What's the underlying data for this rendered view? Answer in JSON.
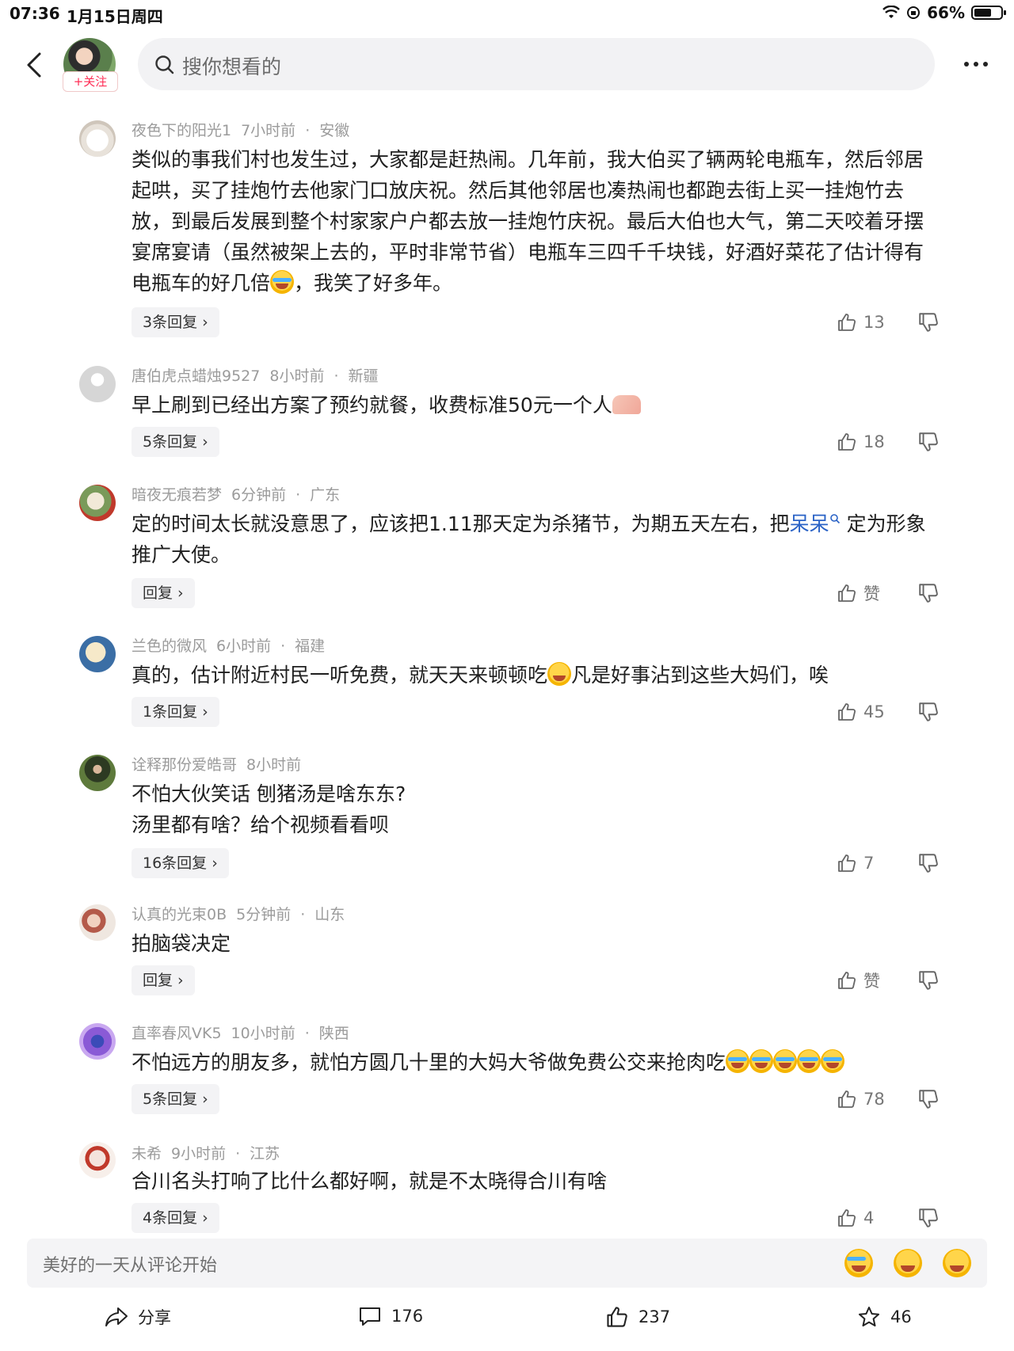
{
  "status": {
    "time": "07:36",
    "date": "1月15日周四",
    "battery": "66%",
    "battery_level": 0.66
  },
  "header": {
    "follow_label": "+关注",
    "search_placeholder": "搜你想看的"
  },
  "comments": [
    {
      "user": "夜色下的阳光1",
      "time": "7小时前",
      "location": "安徽",
      "text_parts": [
        "类似的事我们村也发生过，大家都是赶热闹。几年前，我大伯买了辆两轮电瓶车，然后邻居起哄，买了挂炮竹去他家门口放庆祝。然后其他邻居也凑热闹也都跑去街上买一挂炮竹去放，到最后发展到整个村家家户户都去放一挂炮竹庆祝。最后大伯也大气，第二天咬着牙摆宴席宴请（虽然被架上去的，平时非常节省）电瓶车三四千千块钱，好酒好菜花了估计得有电瓶车的好几倍",
        "，我笑了好多年。"
      ],
      "replies": "3条回复",
      "likes": "13"
    },
    {
      "user": "唐伯虎点蜡烛9527",
      "time": "8小时前",
      "location": "新疆",
      "text_parts": [
        "早上刷到已经出方案了预约就餐，收费标准50元一个人"
      ],
      "replies": "5条回复",
      "likes": "18"
    },
    {
      "user": "暗夜无痕若梦",
      "time": "6分钟前",
      "location": "广东",
      "text_parts": [
        "定的时间太长就没意思了，应该把1.11那天定为杀猪节，为期五天左右，把",
        "呆呆",
        "定为形象推广大使。"
      ],
      "replies": "回复",
      "likes": "赞"
    },
    {
      "user": "兰色的微风",
      "time": "6小时前",
      "location": "福建",
      "text_parts": [
        "真的，估计附近村民一听免费，就天天来顿顿吃",
        "凡是好事沾到这些大妈们，唉"
      ],
      "replies": "1条回复",
      "likes": "45"
    },
    {
      "user": "诠释那份爱皓哥",
      "time": "8小时前",
      "location": "",
      "text_parts": [
        "不怕大伙笑话 刨猪汤是啥东东?",
        "汤里都有啥？给个视频看看呗"
      ],
      "replies": "16条回复",
      "likes": "7"
    },
    {
      "user": "认真的光束0B",
      "time": "5分钟前",
      "location": "山东",
      "text_parts": [
        "拍脑袋决定"
      ],
      "replies": "回复",
      "likes": "赞"
    },
    {
      "user": "直率春风VK5",
      "time": "10小时前",
      "location": "陕西",
      "text_parts": [
        "不怕远方的朋友多，就怕方圆几十里的大妈大爷做免费公交来抢肉吃"
      ],
      "replies": "5条回复",
      "likes": "78"
    },
    {
      "user": "未希",
      "time": "9小时前",
      "location": "江苏",
      "text_parts": [
        "合川名头打响了比什么都好啊，就是不太晓得合川有啥"
      ],
      "replies": "4条回复",
      "likes": "4"
    }
  ],
  "input": {
    "placeholder": "美好的一天从评论开始"
  },
  "bottom_bar": {
    "share": "分享",
    "comments": "176",
    "likes": "237",
    "favorites": "46"
  },
  "colors": {
    "accent": "#ff2d55",
    "link": "#2b63c6",
    "meta": "#9b9b9b"
  },
  "icons": [
    "back-icon",
    "search-icon",
    "more-icon",
    "like-icon",
    "dislike-icon",
    "share-icon",
    "comment-icon",
    "star-icon"
  ]
}
